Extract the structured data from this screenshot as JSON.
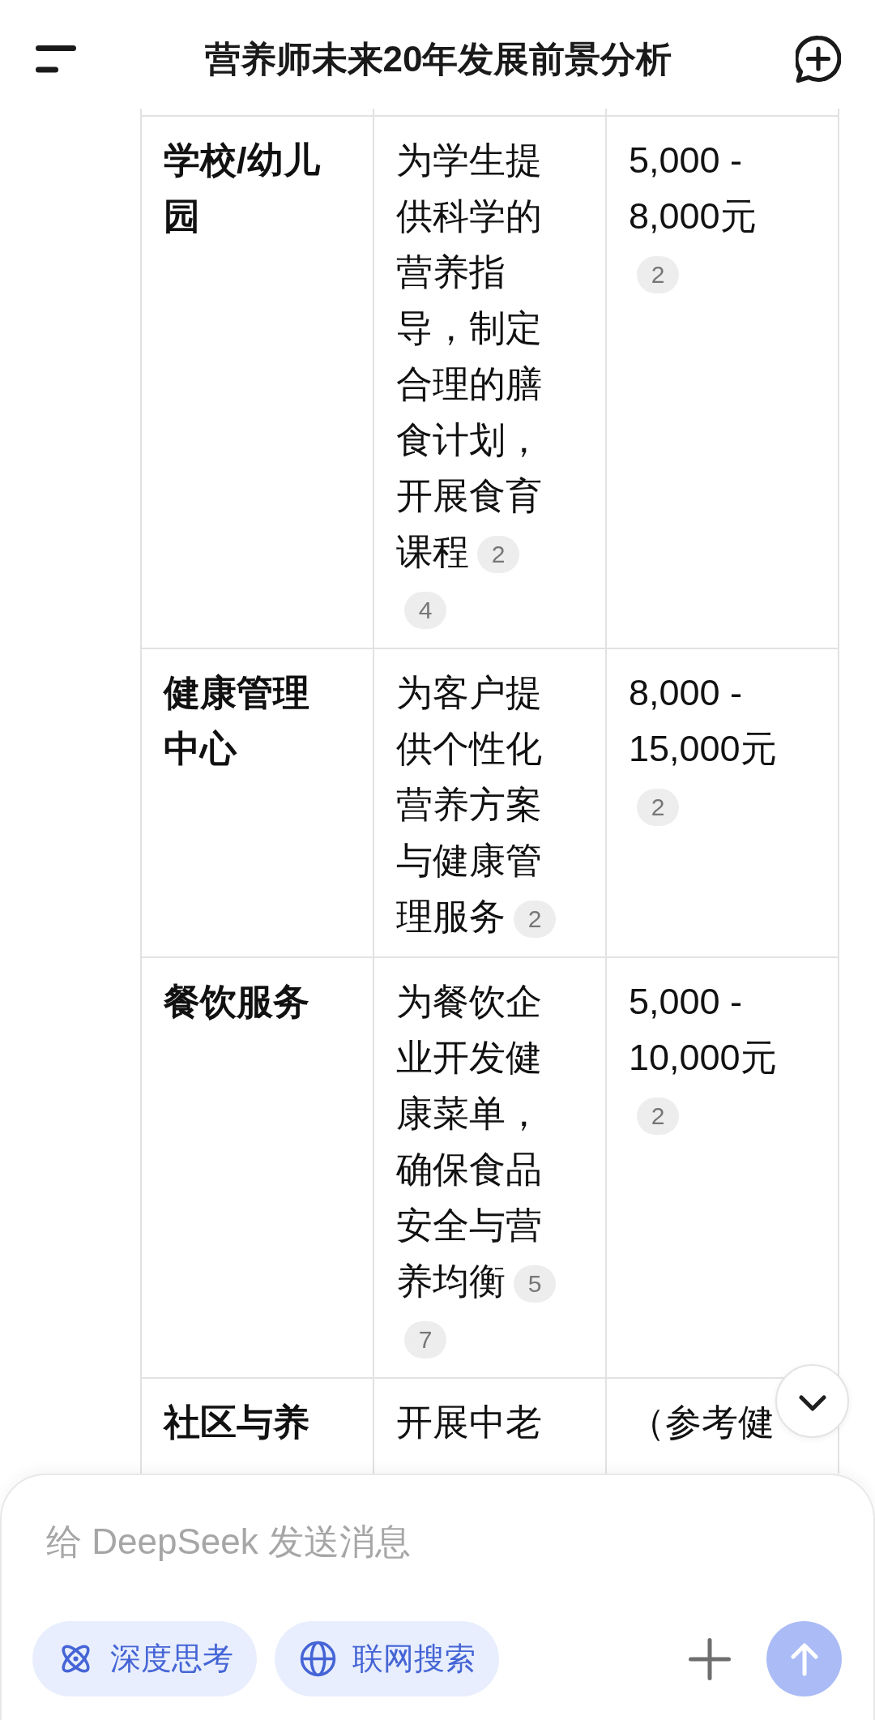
{
  "header": {
    "title": "营养师未来20年发展前景分析"
  },
  "table": {
    "rows": [
      {
        "column_1": {
          "text": "学校/幼儿园"
        },
        "column_2": {
          "text": "为学生提供科学的营养指导，制定合理的膳食计划，开展食育课程",
          "citations": [
            "2",
            "4"
          ]
        },
        "column_3": {
          "text": "5,000 - 8,000元",
          "citations": [
            "2"
          ]
        }
      },
      {
        "column_1": {
          "text": "健康管理中心"
        },
        "column_2": {
          "text": "为客户提供个性化营养方案与健康管理服务",
          "citations": [
            "2"
          ]
        },
        "column_3": {
          "text": "8,000 - 15,000元",
          "citations": [
            "2"
          ]
        }
      },
      {
        "column_1": {
          "text": "餐饮服务"
        },
        "column_2": {
          "text": "为餐饮企业开发健康菜单，确保食品安全与营养均衡",
          "citations": [
            "5",
            "7"
          ]
        },
        "column_3": {
          "text": "5,000 - 10,000元",
          "citations": [
            "2"
          ]
        }
      },
      {
        "column_1": {
          "text": "社区与养"
        },
        "column_2": {
          "text": "开展中老"
        },
        "column_3": {
          "text": "（参考健"
        }
      }
    ]
  },
  "composer": {
    "placeholder": "给 DeepSeek 发送消息",
    "toggles": [
      {
        "kind": "think",
        "label": "深度思考",
        "selected": true
      },
      {
        "kind": "search",
        "label": "联网搜索",
        "selected": true
      }
    ],
    "send_button": {
      "disabled": true
    }
  }
}
